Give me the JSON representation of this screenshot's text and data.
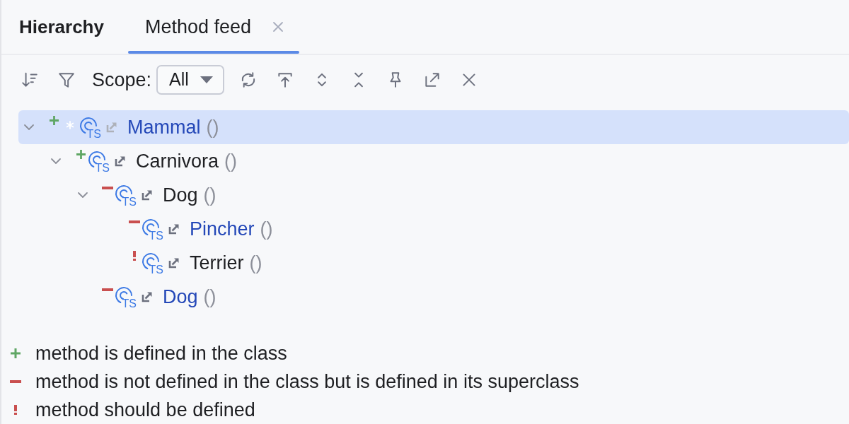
{
  "panel": {
    "title": "Hierarchy"
  },
  "tabs": [
    {
      "label": "Method feed",
      "selected": true,
      "closable": true
    }
  ],
  "toolbar": {
    "scope_label": "Scope:",
    "scope": {
      "value": "All"
    }
  },
  "tree": [
    {
      "name": "Mammal",
      "params": "()",
      "kind": "defined",
      "current": true,
      "selected": true,
      "highlighted": true,
      "tag": "TS",
      "expanded": true,
      "children": [
        {
          "name": "Carnivora",
          "params": "()",
          "kind": "defined",
          "current": false,
          "selected": false,
          "highlighted": false,
          "tag": "TS",
          "expanded": true,
          "children": [
            {
              "name": "Dog",
              "params": "()",
              "kind": "inherited",
              "current": false,
              "selected": false,
              "highlighted": false,
              "tag": "TS",
              "expanded": true,
              "children": [
                {
                  "name": "Pincher",
                  "params": "()",
                  "kind": "inherited",
                  "current": false,
                  "selected": false,
                  "highlighted": true,
                  "tag": "TS"
                },
                {
                  "name": "Terrier",
                  "params": "()",
                  "kind": "should_define",
                  "current": false,
                  "selected": false,
                  "highlighted": false,
                  "tag": "TS"
                }
              ]
            },
            {
              "name": "Dog",
              "params": "()",
              "kind": "inherited",
              "current": false,
              "selected": false,
              "highlighted": true,
              "tag": "TS"
            }
          ]
        }
      ]
    }
  ],
  "legend": [
    {
      "kind": "defined",
      "text": "method is defined in the class"
    },
    {
      "kind": "inherited",
      "text": "method is not defined in the class but is defined in its superclass"
    },
    {
      "kind": "should_define",
      "text": "method should be defined"
    }
  ]
}
